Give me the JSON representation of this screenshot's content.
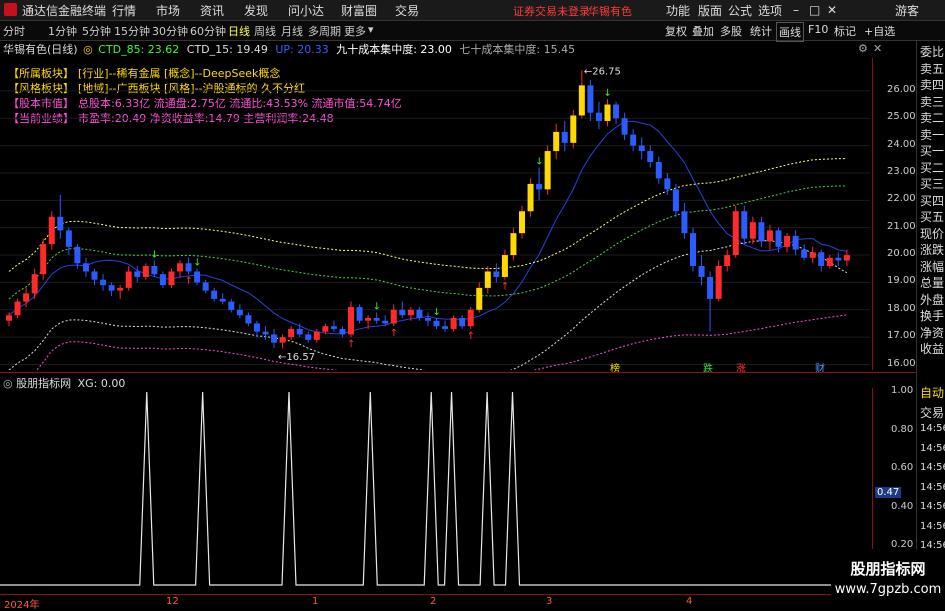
{
  "app": {
    "title": "通达信金融终端",
    "menus": [
      "行情",
      "市场",
      "资讯",
      "发现",
      "问小达",
      "财富圈",
      "交易"
    ],
    "warning": "证券交易未登录",
    "stock_name": "华锡有色",
    "right_menus": [
      "功能",
      "版面",
      "公式",
      "选项"
    ],
    "guest": "游客"
  },
  "periods": [
    "分时",
    "1分钟",
    "5分钟",
    "15分钟",
    "30分钟",
    "60分钟",
    "日线",
    "周线",
    "月线",
    "多周期",
    "更多"
  ],
  "active_period": "日线",
  "right_tools": [
    "复权",
    "叠加",
    "多股",
    "统计",
    "画线",
    "F10",
    "标记",
    "+自选"
  ],
  "chart_header": {
    "title": "华锡有色(日线)",
    "ctd85": "CTD_85: 23.62",
    "ctd15": "CTD_15: 19.49",
    "up": "UP: 20.33",
    "cost90": "九十成本集中度: 23.00",
    "cost70": "七十成本集中度: 15.45"
  },
  "info_lines": [
    {
      "label": "【所属板块】",
      "text": "[行业]--稀有金属 [概念]--DeepSeek概念",
      "color": "#ffd900"
    },
    {
      "label": "【风格板块】",
      "text": "[地域]--广西板块 [风格]--沪股通标的 久不分红",
      "color": "#ffd900"
    },
    {
      "label": "【股本市值】",
      "text": "总股本:6.33亿 流通盘:2.75亿 流通比:43.53% 流通市值:54.74亿",
      "color": "#ff4fd8"
    },
    {
      "label": "【当前业绩】",
      "text": "市盈率:20.49 净资收益率:14.79 主营利润率:24.48",
      "color": "#ff4fd8"
    }
  ],
  "price_axis": [
    "26.00",
    "25.00",
    "24.00",
    "23.00",
    "22.00",
    "21.00",
    "20.00",
    "19.00",
    "18.00",
    "17.00",
    "16.00"
  ],
  "annotations": {
    "high": "26.75",
    "low": "16.57"
  },
  "events": [
    {
      "text": "榜",
      "color": "#ffd900"
    },
    {
      "text": "跌",
      "color": "#33dd33"
    },
    {
      "text": "涨",
      "color": "#ff3333"
    },
    {
      "text": "财",
      "color": "#3aa0ff"
    }
  ],
  "indicator": {
    "title": "股朋指标网",
    "value": "XG: 0.00",
    "axis": [
      "1.00",
      "0.80",
      "0.60",
      "0.40",
      "0.20"
    ],
    "marker": "0.47"
  },
  "date_axis": [
    "2024年",
    "12",
    "1",
    "2",
    "3",
    "4"
  ],
  "side_panel": [
    "委比",
    "卖五",
    "卖四",
    "卖三",
    "卖二",
    "卖一",
    "买一",
    "买二",
    "买三",
    "买四",
    "买五",
    "现价",
    "涨跌",
    "涨幅",
    "总量",
    "外盘",
    "换手",
    "净资",
    "收益"
  ],
  "side_panel2": [
    "自动",
    "交易",
    "14:56",
    "14:56",
    "14:56",
    "14:56",
    "14:56",
    "14:56",
    "14:56",
    "14:56"
  ],
  "watermark": {
    "line1": "股朋指标网",
    "line2": "www.7gpzb.com"
  },
  "chart_data": {
    "type": "candlestick",
    "title": "华锡有色(日线)",
    "ylim": [
      15.8,
      27.2
    ],
    "x_ticks": [
      "2024年",
      "12",
      "1",
      "2",
      "3",
      "4"
    ],
    "candles": [
      [
        17.6,
        17.9,
        17.4,
        17.8
      ],
      [
        17.8,
        18.4,
        17.7,
        18.3
      ],
      [
        18.3,
        18.8,
        18.1,
        18.6
      ],
      [
        18.6,
        19.5,
        18.4,
        19.3
      ],
      [
        19.3,
        20.6,
        19.1,
        20.4
      ],
      [
        20.4,
        21.6,
        20.2,
        21.4
      ],
      [
        21.4,
        22.2,
        20.6,
        20.9
      ],
      [
        20.9,
        21.0,
        20.0,
        20.3
      ],
      [
        20.3,
        20.4,
        19.5,
        19.7
      ],
      [
        19.7,
        19.9,
        19.2,
        19.4
      ],
      [
        19.4,
        19.5,
        18.9,
        19.1
      ],
      [
        19.1,
        19.3,
        18.7,
        18.9
      ],
      [
        18.9,
        19.0,
        18.5,
        18.7
      ],
      [
        18.7,
        18.9,
        18.4,
        18.8
      ],
      [
        18.8,
        19.6,
        18.7,
        19.4
      ],
      [
        19.4,
        19.6,
        19.0,
        19.2
      ],
      [
        19.2,
        19.7,
        19.1,
        19.6
      ],
      [
        19.6,
        19.8,
        19.2,
        19.3
      ],
      [
        19.3,
        19.4,
        18.8,
        18.9
      ],
      [
        18.9,
        19.5,
        18.8,
        19.4
      ],
      [
        19.4,
        19.8,
        19.2,
        19.7
      ],
      [
        19.7,
        19.9,
        19.3,
        19.4
      ],
      [
        19.4,
        19.5,
        18.9,
        19.0
      ],
      [
        19.0,
        19.1,
        18.6,
        18.7
      ],
      [
        18.7,
        18.8,
        18.3,
        18.4
      ],
      [
        18.4,
        18.6,
        18.2,
        18.3
      ],
      [
        18.3,
        18.4,
        17.9,
        18.0
      ],
      [
        18.0,
        18.2,
        17.7,
        17.8
      ],
      [
        17.8,
        17.9,
        17.4,
        17.5
      ],
      [
        17.5,
        17.6,
        17.0,
        17.2
      ],
      [
        17.2,
        17.4,
        16.9,
        17.1
      ],
      [
        17.1,
        17.3,
        16.6,
        16.8
      ],
      [
        16.8,
        17.1,
        16.6,
        17.0
      ],
      [
        17.0,
        17.4,
        16.9,
        17.3
      ],
      [
        17.3,
        17.5,
        17.0,
        17.1
      ],
      [
        17.1,
        17.2,
        16.8,
        16.9
      ],
      [
        16.9,
        17.3,
        16.8,
        17.2
      ],
      [
        17.2,
        17.5,
        17.1,
        17.4
      ],
      [
        17.4,
        17.6,
        17.2,
        17.3
      ],
      [
        17.3,
        17.4,
        17.0,
        17.1
      ],
      [
        17.1,
        18.3,
        17.0,
        18.1
      ],
      [
        18.1,
        18.2,
        17.5,
        17.6
      ],
      [
        17.6,
        17.8,
        17.3,
        17.7
      ],
      [
        17.7,
        17.9,
        17.5,
        17.6
      ],
      [
        17.6,
        17.8,
        17.4,
        17.5
      ],
      [
        17.5,
        18.2,
        17.4,
        18.0
      ],
      [
        18.0,
        18.3,
        17.7,
        17.8
      ],
      [
        17.8,
        18.1,
        17.6,
        18.0
      ],
      [
        18.0,
        18.1,
        17.6,
        17.7
      ],
      [
        17.7,
        17.9,
        17.4,
        17.6
      ],
      [
        17.6,
        17.7,
        17.3,
        17.4
      ],
      [
        17.4,
        17.6,
        17.2,
        17.3
      ],
      [
        17.3,
        17.8,
        17.2,
        17.7
      ],
      [
        17.7,
        17.8,
        17.3,
        17.4
      ],
      [
        17.4,
        18.1,
        17.3,
        18.0
      ],
      [
        18.0,
        19.0,
        17.9,
        18.8
      ],
      [
        18.8,
        19.6,
        18.6,
        19.4
      ],
      [
        19.4,
        19.7,
        19.0,
        19.2
      ],
      [
        19.2,
        20.2,
        19.1,
        20.0
      ],
      [
        20.0,
        21.0,
        19.8,
        20.8
      ],
      [
        20.8,
        21.8,
        20.6,
        21.6
      ],
      [
        21.6,
        22.8,
        21.4,
        22.6
      ],
      [
        22.6,
        23.2,
        22.0,
        22.4
      ],
      [
        22.4,
        24.0,
        22.2,
        23.8
      ],
      [
        23.8,
        24.8,
        23.5,
        24.5
      ],
      [
        24.5,
        24.9,
        23.8,
        24.1
      ],
      [
        24.1,
        25.3,
        23.9,
        25.1
      ],
      [
        25.1,
        26.75,
        25.0,
        26.2
      ],
      [
        26.2,
        26.4,
        24.9,
        25.2
      ],
      [
        25.2,
        25.6,
        24.6,
        24.9
      ],
      [
        24.9,
        25.7,
        24.7,
        25.5
      ],
      [
        25.5,
        25.6,
        24.8,
        25.0
      ],
      [
        25.0,
        25.2,
        24.2,
        24.4
      ],
      [
        24.4,
        24.6,
        23.8,
        24.0
      ],
      [
        24.0,
        24.3,
        23.5,
        23.8
      ],
      [
        23.8,
        24.0,
        23.2,
        23.4
      ],
      [
        23.4,
        23.6,
        22.6,
        22.8
      ],
      [
        22.8,
        23.0,
        22.2,
        22.4
      ],
      [
        22.4,
        22.6,
        21.4,
        21.6
      ],
      [
        21.6,
        21.9,
        20.6,
        20.8
      ],
      [
        20.8,
        21.0,
        19.4,
        19.6
      ],
      [
        19.6,
        20.0,
        18.9,
        19.2
      ],
      [
        19.2,
        19.4,
        17.2,
        18.4
      ],
      [
        18.4,
        19.8,
        18.3,
        19.6
      ],
      [
        19.6,
        20.2,
        19.4,
        20.0
      ],
      [
        20.0,
        21.8,
        19.9,
        21.6
      ],
      [
        21.6,
        21.8,
        20.4,
        20.6
      ],
      [
        20.6,
        21.4,
        20.4,
        21.2
      ],
      [
        21.2,
        21.4,
        20.3,
        20.5
      ],
      [
        20.5,
        21.1,
        20.2,
        20.9
      ],
      [
        20.9,
        21.0,
        20.1,
        20.3
      ],
      [
        20.3,
        20.8,
        20.1,
        20.7
      ],
      [
        20.7,
        20.9,
        20.0,
        20.2
      ],
      [
        20.2,
        20.4,
        19.8,
        19.9
      ],
      [
        19.9,
        20.3,
        19.7,
        20.1
      ],
      [
        20.1,
        20.2,
        19.4,
        19.6
      ],
      [
        19.6,
        20.0,
        19.5,
        19.9
      ],
      [
        19.9,
        20.1,
        19.6,
        19.8
      ],
      [
        19.8,
        20.2,
        19.6,
        20.0
      ]
    ],
    "signal_bars": [
      17,
      22,
      43,
      50,
      62,
      70
    ]
  }
}
